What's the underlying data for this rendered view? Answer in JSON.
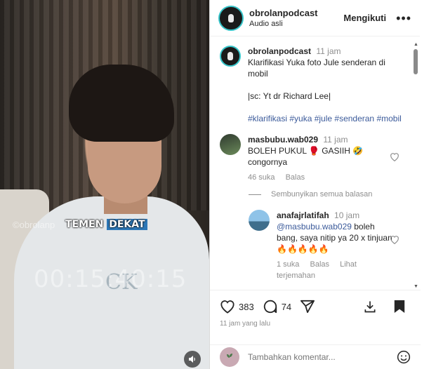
{
  "video": {
    "overlay_account": "obrolanp",
    "caption_word1": "TEMEN",
    "caption_word2": "DEKAT",
    "timecode": "00:15:40:15",
    "shirt_logo": "CK"
  },
  "header": {
    "username": "obrolanpodcast",
    "subtitle": "Audio asli",
    "follow_label": "Mengikuti",
    "more_icon": "more-horizontal-icon"
  },
  "post": {
    "username": "obrolanpodcast",
    "time": "11 jam",
    "caption_line1": "Klarifikasi Yuka foto Jule senderan di mobil",
    "caption_line2": "|sc: Yt dr Richard Lee|",
    "hashtags": "#klarifikasi #yuka #jule #senderan #mobil"
  },
  "comments": [
    {
      "username": "masbubu.wab029",
      "time": "11 jam",
      "text": "BOLEH PUKUL 🥊 GASIIH 🤣 congornya",
      "likes": "46 suka",
      "reply_label": "Balas"
    }
  ],
  "hide_replies_label": "Sembunyikan semua balasan",
  "reply": {
    "username": "anafajrlatifah",
    "time": "10 jam",
    "mention": "@masbubu.wab029",
    "text": " boleh bang, saya nitip ya 20 x tinjuan 🔥🔥🔥🔥🔥",
    "likes": "1 suka",
    "reply_label": "Balas",
    "view_translation": "Lihat terjemahan"
  },
  "footer": {
    "like_count": "383",
    "comment_count": "74",
    "time_ago": "11 jam yang lalu",
    "composer_placeholder": "Tambahkan komentar..."
  },
  "colors": {
    "caption_highlight": "#2e78b7",
    "link": "#3b5a9a",
    "muted": "#8e8e8e",
    "avatar_ring": "#36c4c9"
  }
}
